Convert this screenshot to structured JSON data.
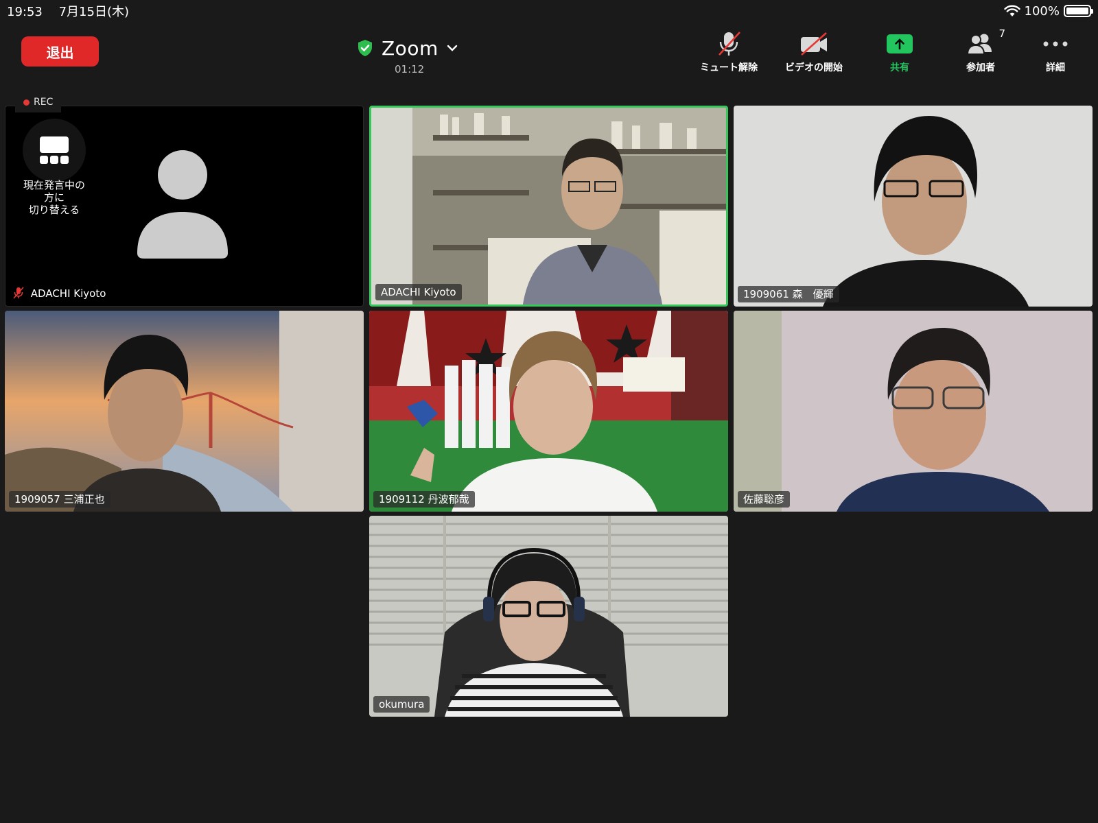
{
  "status_bar": {
    "time": "19:53",
    "date": "7月15日(木)",
    "battery": "100%"
  },
  "toolbar": {
    "leave_label": "退出",
    "meeting_title": "Zoom",
    "elapsed": "01:12",
    "unmute_label": "ミュート解除",
    "video_label": "ビデオの開始",
    "share_label": "共有",
    "participants_label": "参加者",
    "participants_count": "7",
    "more_label": "詳細"
  },
  "rec_label": "REC",
  "switch_view_label": [
    "現在発言中の",
    "方に",
    "切り替える"
  ],
  "participants": [
    {
      "name": "ADACHI Kiyoto"
    },
    {
      "name": "ADACHI Kiyoto"
    },
    {
      "name": "1909061 森　優輝"
    },
    {
      "name": "1909057 三浦正也"
    },
    {
      "name": "1909112 丹波郁哉"
    },
    {
      "name": "佐藤聡彦"
    },
    {
      "name": "okumura"
    }
  ],
  "colors": {
    "leave": "#e02828",
    "share": "#22c55e",
    "active_speaker": "#38c75a",
    "rec_dot": "#e53935"
  }
}
